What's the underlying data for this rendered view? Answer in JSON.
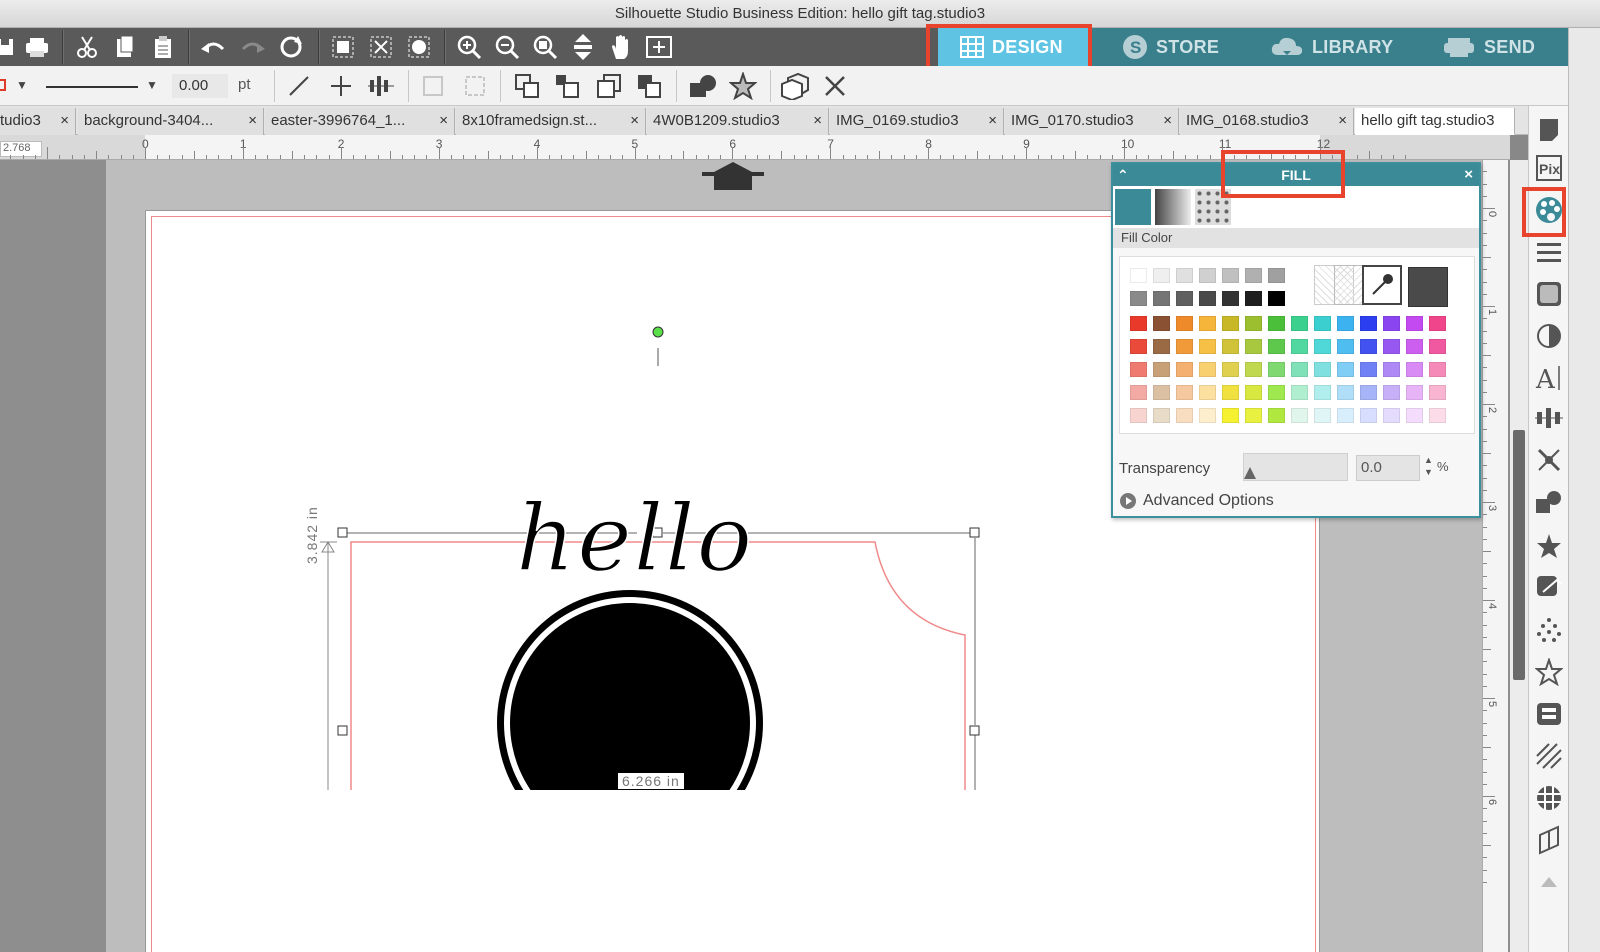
{
  "window": {
    "title": "Silhouette Studio Business Edition: hello gift tag.studio3"
  },
  "nav": {
    "design": "DESIGN",
    "store": "STORE",
    "library": "LIBRARY",
    "send": "SEND"
  },
  "toolbar2": {
    "line_weight": "0.00",
    "line_unit": "pt"
  },
  "doc_tabs": [
    {
      "label": "tudio3"
    },
    {
      "label": "background-3404..."
    },
    {
      "label": "easter-3996764_1..."
    },
    {
      "label": "8x10framedsign.st..."
    },
    {
      "label": "4W0B1209.studio3"
    },
    {
      "label": "IMG_0169.studio3"
    },
    {
      "label": "IMG_0170.studio3"
    },
    {
      "label": "IMG_0168.studio3"
    },
    {
      "label": "hello gift tag.studio3"
    }
  ],
  "ruler": {
    "cursor_readout": "2.768",
    "numbers": [
      "0",
      "1",
      "2",
      "3",
      "4",
      "5",
      "6",
      "7",
      "8",
      "9",
      "10",
      "11",
      "12"
    ]
  },
  "vruler": {
    "numbers": [
      "0",
      "1",
      "2",
      "3",
      "4",
      "5",
      "6"
    ]
  },
  "canvas": {
    "height_dim": "3.842 in",
    "width_dim": "6.266 in",
    "artwork_text": "hello"
  },
  "fill_panel": {
    "title": "FILL",
    "section_label": "Fill Color",
    "transparency_label": "Transparency",
    "transparency_value": "0.0",
    "transparency_unit": "%",
    "advanced_label": "Advanced Options",
    "accent_color": "#3a8a97",
    "grays_row1": [
      "#ffffff",
      "#efefef",
      "#e0e0e0",
      "#d0d0d0",
      "#c0c0c0",
      "#b0b0b0",
      "#a0a0a0"
    ],
    "grays_row2": [
      "#8a8a8a",
      "#757575",
      "#606060",
      "#4a4a4a",
      "#333333",
      "#1e1e1e",
      "#000000"
    ],
    "color_rows": [
      [
        "#e8392a",
        "#8a5232",
        "#ef8a2a",
        "#f5b43a",
        "#c8b828",
        "#9bbf2e",
        "#4cbf3a",
        "#3cd08f",
        "#3ccfd0",
        "#3cb3f0",
        "#2b3ef0",
        "#8a45f0",
        "#c34af0",
        "#f0458a"
      ],
      [
        "#ea4a3a",
        "#9a6a45",
        "#f09a3a",
        "#f5c045",
        "#d0c33a",
        "#a8c83f",
        "#5ec84c",
        "#50d8a0",
        "#50d8d8",
        "#50bdf0",
        "#4252f0",
        "#9658f0",
        "#cc5ef0",
        "#f058a0"
      ],
      [
        "#ef7a70",
        "#c8a078",
        "#f3b070",
        "#f8d070",
        "#e0d050",
        "#c0d850",
        "#80d870",
        "#80e0b8",
        "#80e0e0",
        "#80cdf5",
        "#7080f5",
        "#ae88f5",
        "#d88af5",
        "#f58ab8"
      ],
      [
        "#f4aaa4",
        "#dcc0a4",
        "#f6c8a0",
        "#fbe0a0",
        "#f0e040",
        "#d8e840",
        "#a0e850",
        "#b0eed0",
        "#b0eeee",
        "#b0def8",
        "#a8b4f8",
        "#c8b0f8",
        "#e8b4f8",
        "#f8b4d0"
      ],
      [
        "#f8d4d0",
        "#e8dcc8",
        "#f8ddc0",
        "#fdeecd",
        "#f5f030",
        "#e8f040",
        "#b0e840",
        "#e0f6ec",
        "#e0f6f6",
        "#d8eefc",
        "#d8deff",
        "#e4dcfc",
        "#f4dcfc",
        "#fcdce8"
      ]
    ]
  }
}
